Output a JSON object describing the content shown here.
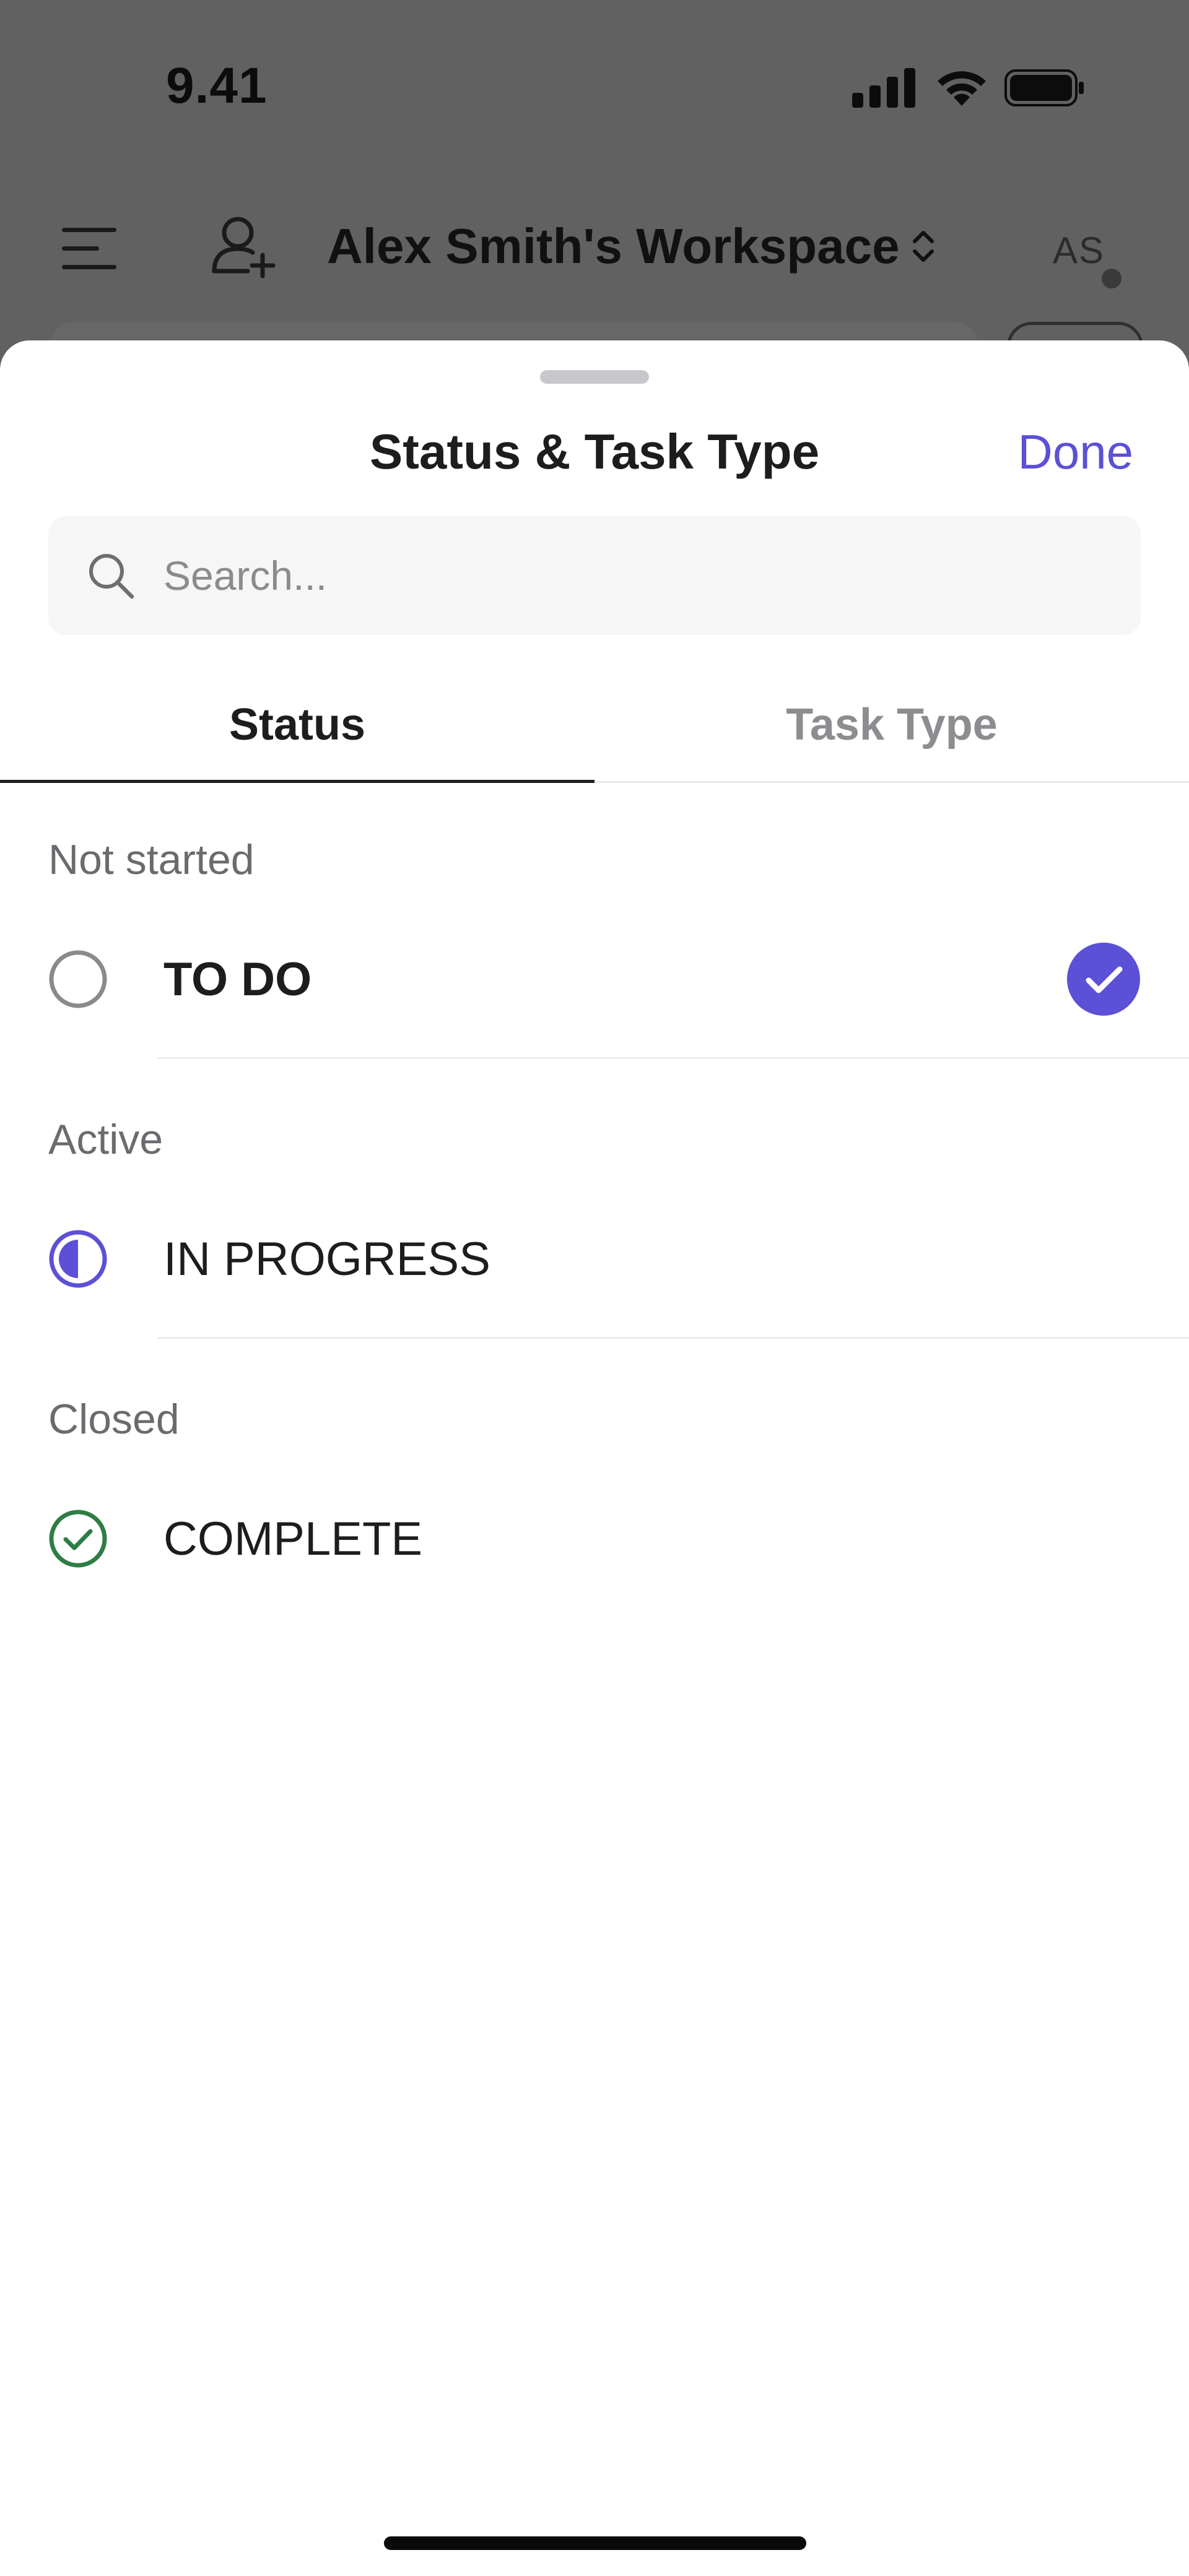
{
  "status_bar": {
    "time": "9.41",
    "icons": [
      "cellular-signal-icon",
      "wifi-icon",
      "battery-icon"
    ]
  },
  "app_header": {
    "workspace_title": "Alex Smith's Workspace",
    "avatar_initials": "AS",
    "icons": [
      "menu-icon",
      "add-user-icon",
      "chevron-updown-icon"
    ]
  },
  "sheet": {
    "title": "Status & Task Type",
    "done_label": "Done",
    "search": {
      "placeholder": "Search...",
      "value": ""
    },
    "tabs": [
      {
        "label": "Status",
        "selected": true
      },
      {
        "label": "Task Type",
        "selected": false
      }
    ],
    "groups": [
      {
        "label": "Not started",
        "items": [
          {
            "label": "TO DO",
            "icon": "circle-empty-icon",
            "selected": true
          }
        ]
      },
      {
        "label": "Active",
        "items": [
          {
            "label": "IN PROGRESS",
            "icon": "half-circle-icon",
            "selected": false
          }
        ]
      },
      {
        "label": "Closed",
        "items": [
          {
            "label": "COMPLETE",
            "icon": "check-circle-icon",
            "selected": false
          }
        ]
      }
    ]
  },
  "colors": {
    "accent": "#5b50d6",
    "complete_green": "#2e7d45",
    "empty_gray": "#8a8a8a",
    "overlay": "#616161"
  }
}
